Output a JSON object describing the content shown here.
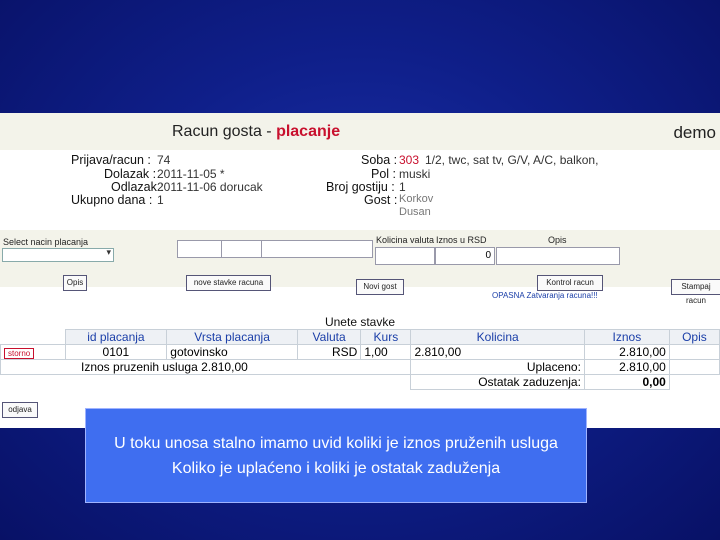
{
  "header": {
    "title_prefix": "Racun gosta - ",
    "title_highlight": "placanje",
    "demo": "demo"
  },
  "info": {
    "prijava_label": "Prijava/racun :",
    "prijava_value": "74",
    "dolazak_label": "Dolazak :",
    "dolazak_value": "2011-11-05 *",
    "odlazak_label": "Odlazak :",
    "odlazak_value": "2011-11-06 dorucak",
    "ukupno_label": "Ukupno dana :",
    "ukupno_value": "1",
    "soba_label": "Soba :",
    "soba_number": "303",
    "soba_desc": "1/2, twc, sat tv, G/V, A/C, balkon,",
    "pol_label": "Pol :",
    "pol_value": "muski",
    "broj_label": "Broj gostiju :",
    "broj_value": "1",
    "gost_label": "Gost :",
    "gost_value_1": "Korkov",
    "gost_value_2": "Dusan"
  },
  "controls": {
    "select_label": "Select nacin placanja",
    "kolicina_label": "Kolicina valuta",
    "iznos_label": "Iznos u RSD",
    "opis_label": "Opis",
    "iznos_value": "0",
    "btn_opis": "Opis",
    "btn_nove_stavke": "nove stavke racuna",
    "btn_novi_gost": "Novi gost",
    "btn_kontrol": "Kontrol racun",
    "link_text": "OPASNA Zatvaranja racuna!!!",
    "btn_right": "Stampaj racun"
  },
  "table": {
    "section_title": "Unete stavke",
    "columns": [
      "id placanja",
      "Vrsta placanja",
      "Valuta",
      "Kurs",
      "Kolicina",
      "Iznos",
      "Opis"
    ],
    "row": {
      "action": "storno",
      "id": "0101",
      "vrsta": "gotovinsko",
      "valuta": "RSD",
      "kurs": "1,00",
      "kolicina": "2.810,00",
      "iznos": "2.810,00",
      "opis": ""
    },
    "iznos_pruzenih_label": "Iznos pruzenih usluga 2.810,00",
    "uplaceno_label": "Uplaceno:",
    "uplaceno_value": "2.810,00",
    "ostatak_label": "Ostatak zaduzenja:",
    "ostatak_value": "0,00",
    "btn_odjava": "odjava"
  },
  "note": {
    "line1": "U toku unosa stalno imamo uvid koliki je iznos pruženih usluga",
    "line2": "Koliko je uplaćeno  i koliki je ostatak zaduženja"
  }
}
